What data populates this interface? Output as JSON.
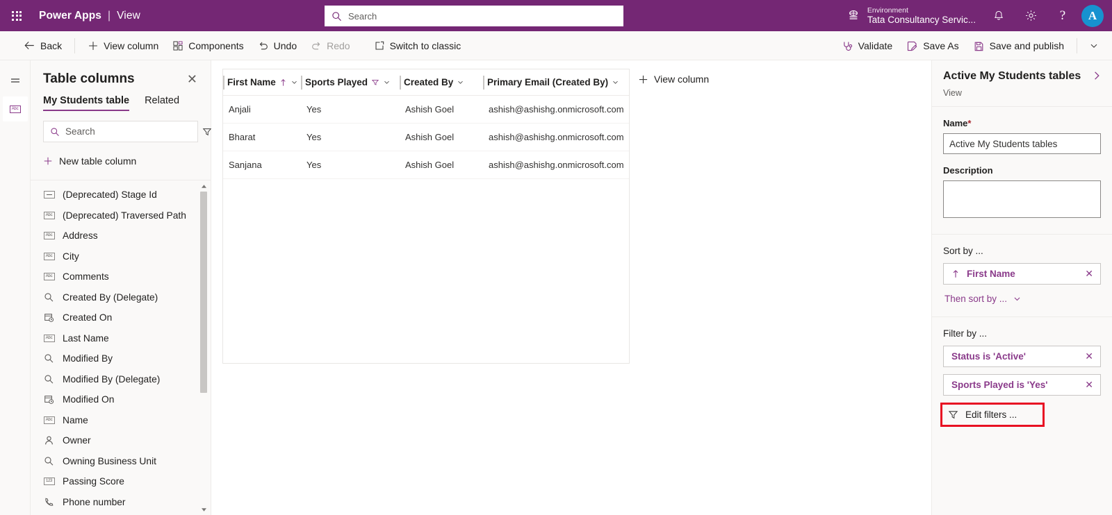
{
  "topbar": {
    "waffle_icon": "app-launcher-icon",
    "brand": "Power Apps",
    "separator": "|",
    "brand_sub": "View",
    "search_placeholder": "Search",
    "search_value": "",
    "search_icon": "search-icon",
    "environment_label": "Environment",
    "environment_name": "Tata Consultancy Servic...",
    "environment_icon": "environment-globe-icon",
    "notification_icon": "bell-icon",
    "settings_icon": "gear-icon",
    "help_icon": "question-mark-icon",
    "avatar_initial": "A",
    "purple": "#742774",
    "avatar_color": "#1792d0"
  },
  "commandbar": {
    "items": [
      {
        "label": "Back",
        "icon": "arrow-left-icon",
        "disabled": false
      },
      {
        "label": "View column",
        "icon": "plus-icon",
        "disabled": false
      },
      {
        "label": "Components",
        "icon": "components-grid-icon",
        "disabled": false
      },
      {
        "label": "Undo",
        "icon": "undo-arrow-icon",
        "disabled": false
      },
      {
        "label": "Redo",
        "icon": "redo-arrow-icon",
        "disabled": true
      },
      {
        "label": "Switch to classic",
        "icon": "open-in-new-icon",
        "disabled": false
      }
    ],
    "right_items": [
      {
        "label": "Validate",
        "icon": "validate-stethoscope-icon"
      },
      {
        "label": "Save As",
        "icon": "save-as-icon"
      },
      {
        "label": "Save and publish",
        "icon": "save-publish-icon"
      }
    ],
    "overflow_icon": "chevron-down-icon"
  },
  "rail": {
    "items": [
      {
        "name": "hamburger-menu-icon",
        "active": false
      },
      {
        "name": "table-columns-icon",
        "active": true
      }
    ]
  },
  "left_panel": {
    "title": "Table columns",
    "close_icon": "close-icon",
    "tabs": [
      {
        "label": "My Students table",
        "active": true
      },
      {
        "label": "Related",
        "active": false
      }
    ],
    "search_placeholder": "Search",
    "search_value": "",
    "search_icon": "search-icon",
    "filter_icon": "filter-icon",
    "filter_chevron_icon": "chevron-down-icon",
    "new_column_label": "New table column",
    "new_column_icon": "plus-icon",
    "columns": [
      {
        "label": "(Deprecated) Stage Id",
        "icon": "unique-identifier-icon",
        "type": "dash"
      },
      {
        "label": "(Deprecated) Traversed Path",
        "icon": "text-abc-icon",
        "type": "abc"
      },
      {
        "label": "Address",
        "icon": "text-abc-icon",
        "type": "abc"
      },
      {
        "label": "City",
        "icon": "text-abc-icon",
        "type": "abc"
      },
      {
        "label": "Comments",
        "icon": "text-abc-icon",
        "type": "abc"
      },
      {
        "label": "Created By (Delegate)",
        "icon": "lookup-magnifier-icon",
        "type": "lookup"
      },
      {
        "label": "Created On",
        "icon": "date-time-icon",
        "type": "datetime"
      },
      {
        "label": "Last Name",
        "icon": "text-abc-icon",
        "type": "abc"
      },
      {
        "label": "Modified By",
        "icon": "lookup-magnifier-icon",
        "type": "lookup"
      },
      {
        "label": "Modified By (Delegate)",
        "icon": "lookup-magnifier-icon",
        "type": "lookup"
      },
      {
        "label": "Modified On",
        "icon": "date-time-icon",
        "type": "datetime"
      },
      {
        "label": "Name",
        "icon": "text-abc-icon",
        "type": "abc"
      },
      {
        "label": "Owner",
        "icon": "owner-person-icon",
        "type": "person"
      },
      {
        "label": "Owning Business Unit",
        "icon": "lookup-magnifier-icon",
        "type": "lookup"
      },
      {
        "label": "Passing Score",
        "icon": "number-123-icon",
        "type": "number"
      },
      {
        "label": "Phone number",
        "icon": "phone-icon",
        "type": "phone"
      }
    ],
    "scroll_up_icon": "caret-up-icon",
    "scroll_down_icon": "caret-down-icon"
  },
  "grid": {
    "view_column_label": "View column",
    "view_column_icon": "plus-icon",
    "columns": [
      {
        "label": "First Name",
        "sorted": true,
        "sort_icon": "sort-ascending-icon",
        "filtered": false,
        "chevron_icon": "chevron-down-icon"
      },
      {
        "label": "Sports Played",
        "sorted": false,
        "filtered": true,
        "filter_icon": "filter-icon",
        "chevron_icon": "chevron-down-icon"
      },
      {
        "label": "Created By",
        "sorted": false,
        "filtered": false,
        "chevron_icon": "chevron-down-icon"
      },
      {
        "label": "Primary Email (Created By)",
        "sorted": false,
        "filtered": false,
        "chevron_icon": "chevron-down-icon"
      }
    ],
    "rows": [
      {
        "first_name": "Anjali",
        "sports_played": "Yes",
        "created_by": "Ashish Goel",
        "primary_email": "ashish@ashishg.onmicrosoft.com"
      },
      {
        "first_name": "Bharat",
        "sports_played": "Yes",
        "created_by": "Ashish Goel",
        "primary_email": "ashish@ashishg.onmicrosoft.com"
      },
      {
        "first_name": "Sanjana",
        "sports_played": "Yes",
        "created_by": "Ashish Goel",
        "primary_email": "ashish@ashishg.onmicrosoft.com"
      }
    ]
  },
  "right_panel": {
    "title": "Active My Students tables",
    "subtitle": "View",
    "expand_icon": "chevron-right-icon",
    "name_label": "Name",
    "name_required_mark": "*",
    "name_value": "Active My Students tables",
    "description_label": "Description",
    "description_value": "",
    "sort_by_label": "Sort by ...",
    "sort_chips": [
      {
        "label": "First Name",
        "direction_icon": "arrow-up-icon",
        "remove_icon": "close-icon"
      }
    ],
    "then_sort_by_label": "Then sort by ...",
    "then_sort_chevron_icon": "chevron-down-icon",
    "filter_by_label": "Filter by ...",
    "filter_chips": [
      {
        "label": "Status is 'Active'",
        "remove_icon": "close-icon"
      },
      {
        "label": "Sports Played is 'Yes'",
        "remove_icon": "close-icon"
      }
    ],
    "edit_filters_label": "Edit filters ...",
    "edit_filters_icon": "filter-icon",
    "highlight_color": "#e81123",
    "accent_color": "#8a3a8a"
  }
}
